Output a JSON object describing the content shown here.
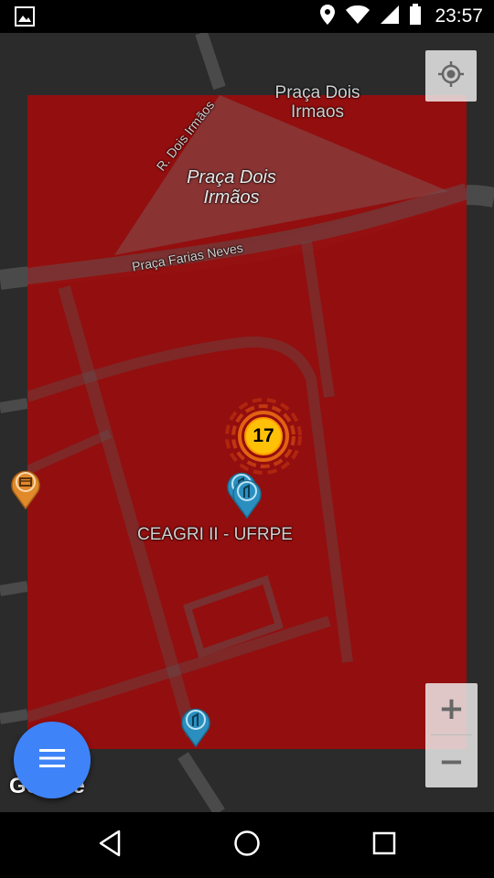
{
  "status_bar": {
    "time": "23:57",
    "icons": [
      "image-icon",
      "location-icon",
      "wifi-icon",
      "signal-icon",
      "battery-icon"
    ]
  },
  "map": {
    "labels": {
      "praca_dois_irmaos_poi": "Praça Dois\nIrmaos",
      "praca_dois_irmaos_park": "Praça Dois\nIrmãos",
      "street_dois_irmaos": "R. Dois Irmãos",
      "street_farias_neves": "Praça Farias Neves",
      "ceagri": "CEAGRI II - UFRPE"
    },
    "overlay_color": "#9b0c0c",
    "cluster": {
      "count": "17",
      "color": "#ffc107"
    },
    "markers": {
      "blue": "#2a8fbf",
      "orange": "#e08a2c"
    },
    "attribution": "Google"
  },
  "controls": {
    "zoom_in": "+",
    "zoom_out": "−",
    "fab_icon": "menu-icon",
    "location_icon": "my-location-icon"
  },
  "nav_bar": {
    "icons": [
      "back-icon",
      "home-icon",
      "recents-icon"
    ]
  }
}
